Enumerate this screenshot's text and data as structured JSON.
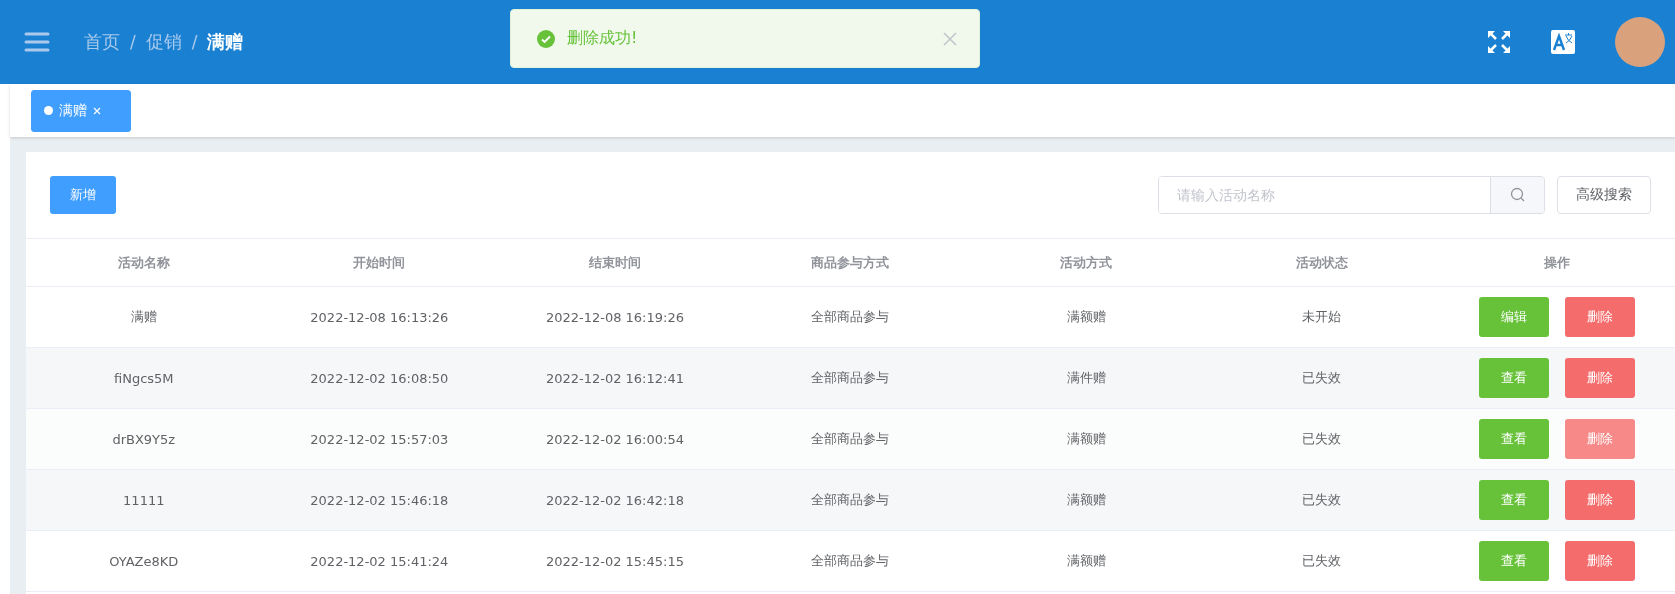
{
  "header": {
    "breadcrumbs": [
      {
        "label": "首页",
        "current": false
      },
      {
        "label": "促销",
        "current": false
      },
      {
        "label": "满赠",
        "current": true
      }
    ],
    "separator": "/"
  },
  "toast": {
    "kind": "success",
    "message": "删除成功!"
  },
  "tabs": [
    {
      "label": "满赠",
      "selected": true
    }
  ],
  "toolbar": {
    "add_button": "新增",
    "search": {
      "placeholder": "请输入活动名称"
    },
    "advanced_button": "高级搜索"
  },
  "table": {
    "columns": [
      "活动名称",
      "开始时间",
      "结束时间",
      "商品参与方式",
      "活动方式",
      "活动状态",
      "操作"
    ],
    "rows": [
      {
        "cells": [
          "满赠",
          "2022-12-08 16:13:26",
          "2022-12-08 16:19:26",
          "全部商品参与",
          "满额赠",
          "未开始"
        ],
        "actions": [
          {
            "kind": "primary",
            "label": "编辑",
            "hovered": false
          },
          {
            "kind": "danger",
            "label": "删除",
            "hovered": false
          }
        ]
      },
      {
        "cells": [
          "fiNgcs5M",
          "2022-12-02 16:08:50",
          "2022-12-02 16:12:41",
          "全部商品参与",
          "满件赠",
          "已失效"
        ],
        "actions": [
          {
            "kind": "primary",
            "label": "查看",
            "hovered": false
          },
          {
            "kind": "danger",
            "label": "删除",
            "hovered": false
          }
        ]
      },
      {
        "cells": [
          "drBX9Y5z",
          "2022-12-02 15:57:03",
          "2022-12-02 16:00:54",
          "全部商品参与",
          "满额赠",
          "已失效"
        ],
        "actions": [
          {
            "kind": "primary",
            "label": "查看",
            "hovered": false
          },
          {
            "kind": "danger",
            "label": "删除",
            "hovered": true
          }
        ]
      },
      {
        "cells": [
          "11111",
          "2022-12-02 15:46:18",
          "2022-12-02 16:42:18",
          "全部商品参与",
          "满额赠",
          "已失效"
        ],
        "actions": [
          {
            "kind": "primary",
            "label": "查看",
            "hovered": false
          },
          {
            "kind": "danger",
            "label": "删除",
            "hovered": false
          }
        ]
      },
      {
        "cells": [
          "OYAZe8KD",
          "2022-12-02 15:41:24",
          "2022-12-02 15:45:15",
          "全部商品参与",
          "满额赠",
          "已失效"
        ],
        "actions": [
          {
            "kind": "primary",
            "label": "查看",
            "hovered": false
          },
          {
            "kind": "danger",
            "label": "删除",
            "hovered": false
          }
        ]
      }
    ]
  }
}
